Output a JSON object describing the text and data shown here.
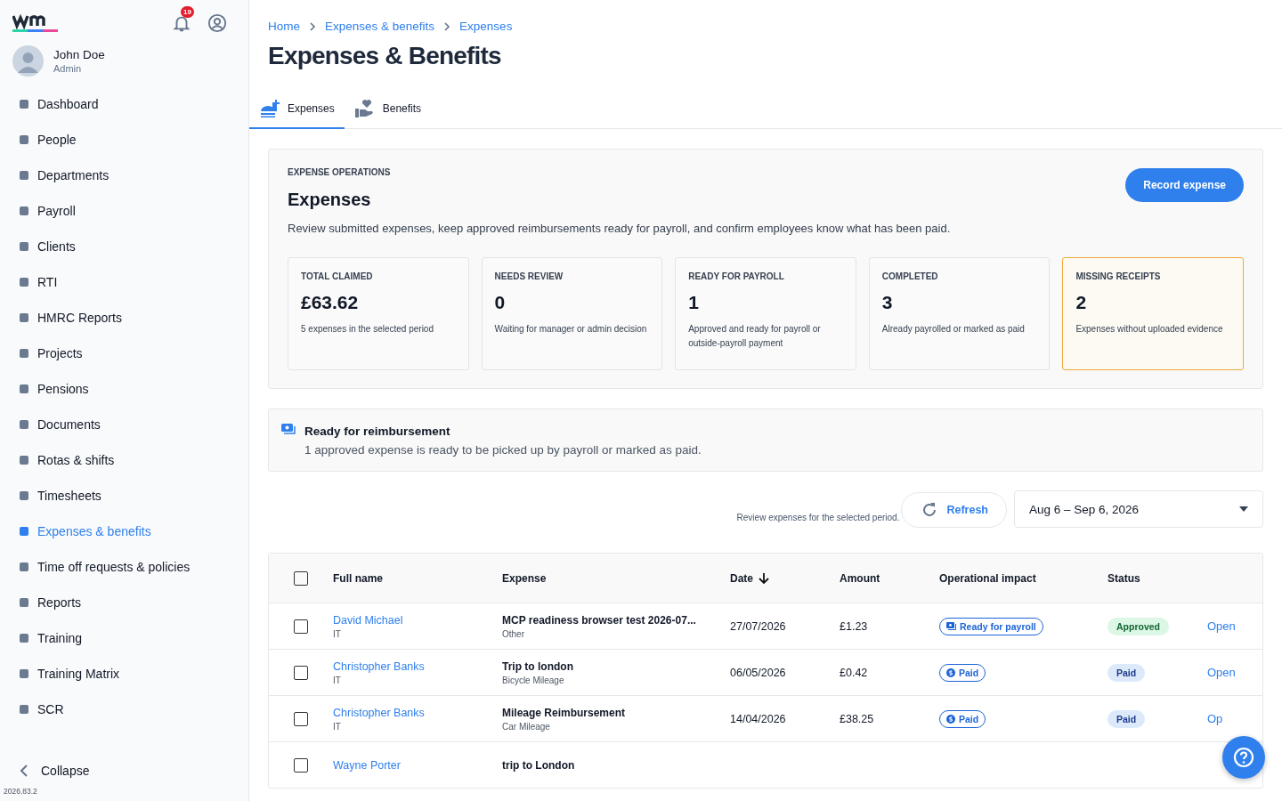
{
  "sidebar": {
    "notification_count": "19",
    "user": {
      "name": "John Doe",
      "role": "Admin"
    },
    "items": [
      {
        "label": "Dashboard",
        "selected": false
      },
      {
        "label": "People",
        "selected": false
      },
      {
        "label": "Departments",
        "selected": false
      },
      {
        "label": "Payroll",
        "selected": false
      },
      {
        "label": "Clients",
        "selected": false
      },
      {
        "label": "RTI",
        "selected": false
      },
      {
        "label": "HMRC Reports",
        "selected": false
      },
      {
        "label": "Projects",
        "selected": false
      },
      {
        "label": "Pensions",
        "selected": false
      },
      {
        "label": "Documents",
        "selected": false
      },
      {
        "label": "Rotas & shifts",
        "selected": false
      },
      {
        "label": "Timesheets",
        "selected": false
      },
      {
        "label": "Expenses & benefits",
        "selected": true
      },
      {
        "label": "Time off requests & policies",
        "selected": false
      },
      {
        "label": "Reports",
        "selected": false
      },
      {
        "label": "Training",
        "selected": false
      },
      {
        "label": "Training Matrix",
        "selected": false
      },
      {
        "label": "SCR",
        "selected": false
      }
    ],
    "collapse": "Collapse",
    "version": "2026.83.2"
  },
  "breadcrumbs": [
    "Home",
    "Expenses & benefits",
    "Expenses"
  ],
  "page_title": "Expenses & Benefits",
  "tabs": [
    {
      "label": "Expenses",
      "selected": true
    },
    {
      "label": "Benefits",
      "selected": false
    }
  ],
  "operations": {
    "eyebrow": "EXPENSE OPERATIONS",
    "title": "Expenses",
    "description": "Review submitted expenses, keep approved reimbursements ready for payroll, and confirm employees know what has been paid.",
    "record_button": "Record expense",
    "stats": [
      {
        "label": "TOTAL CLAIMED",
        "value": "£63.62",
        "note": "5 expenses in the selected period",
        "highlighted": false
      },
      {
        "label": "NEEDS REVIEW",
        "value": "0",
        "note": "Waiting for manager or admin decision",
        "highlighted": false
      },
      {
        "label": "READY FOR PAYROLL",
        "value": "1",
        "note": "Approved and ready for payroll or outside-payroll payment",
        "highlighted": false
      },
      {
        "label": "COMPLETED",
        "value": "3",
        "note": "Already payrolled or marked as paid",
        "highlighted": false
      },
      {
        "label": "MISSING RECEIPTS",
        "value": "2",
        "note": "Expenses without uploaded evidence",
        "highlighted": true
      }
    ]
  },
  "notice": {
    "title": "Ready for reimbursement",
    "text": "1 approved expense is ready to be picked up by payroll or marked as paid."
  },
  "period": {
    "hint": "Review expenses for the selected period.",
    "refresh": "Refresh",
    "range": "Aug 6 – Sep 6, 2026"
  },
  "table": {
    "all_checked": false,
    "columns": [
      {
        "label": "Full name",
        "sorted": false
      },
      {
        "label": "Expense",
        "sorted": false
      },
      {
        "label": "Date",
        "sorted": true
      },
      {
        "label": "Amount",
        "sorted": false
      },
      {
        "label": "Operational impact",
        "sorted": false
      },
      {
        "label": "Status",
        "sorted": false
      }
    ],
    "rows": [
      {
        "checked": false,
        "name": "David Michael",
        "department": "IT",
        "expense": "MCP readiness browser test 2026-07...",
        "category": "Other",
        "date": "27/07/2026",
        "amount": "£1.23",
        "impact": {
          "kind": "ready",
          "label": "Ready for payroll"
        },
        "status": {
          "kind": "approved",
          "label": "Approved"
        },
        "action": "Open"
      },
      {
        "checked": false,
        "name": "Christopher Banks",
        "department": "IT",
        "expense": "Trip to london",
        "category": "Bicycle Mileage",
        "date": "06/05/2026",
        "amount": "£0.42",
        "impact": {
          "kind": "paid",
          "label": "Paid"
        },
        "status": {
          "kind": "paid",
          "label": "Paid"
        },
        "action": "Open"
      },
      {
        "checked": false,
        "name": "Christopher Banks",
        "department": "IT",
        "expense": "Mileage Reimbursement",
        "category": "Car Mileage",
        "date": "14/04/2026",
        "amount": "£38.25",
        "impact": {
          "kind": "paid",
          "label": "Paid"
        },
        "status": {
          "kind": "paid",
          "label": "Paid"
        },
        "action": "Op"
      },
      {
        "checked": false,
        "name": "Wayne Porter",
        "expense": "trip to London"
      }
    ]
  }
}
